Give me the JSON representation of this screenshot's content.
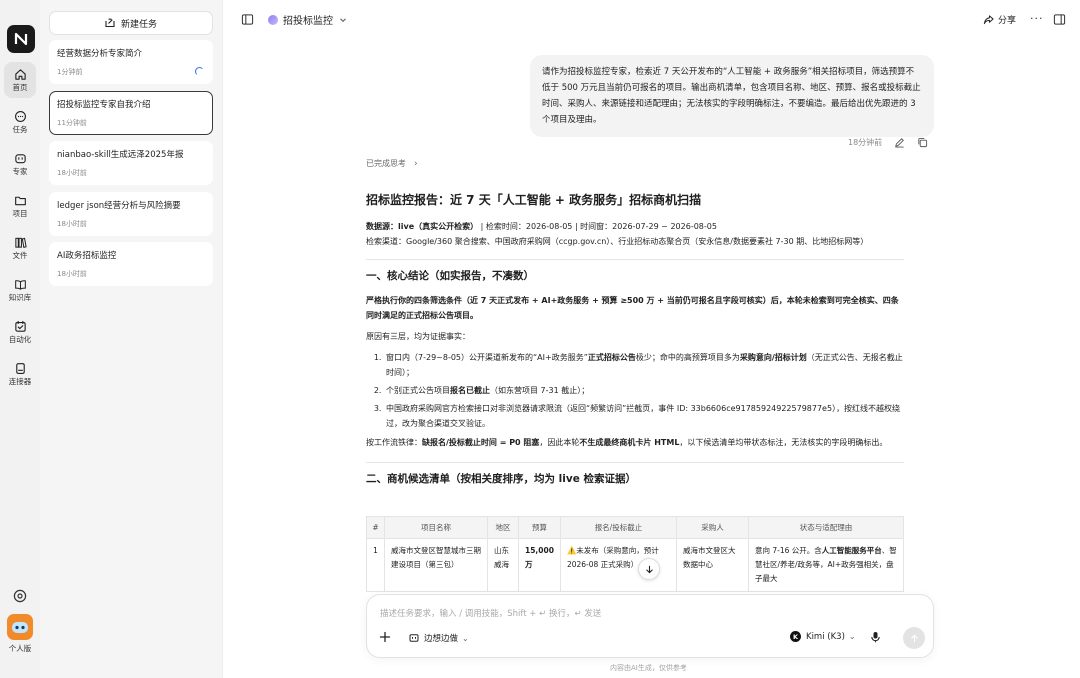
{
  "rail": {
    "items": [
      {
        "label": "首页",
        "icon": "home-icon"
      },
      {
        "label": "任务",
        "icon": "chat-icon"
      },
      {
        "label": "专家",
        "icon": "bot-icon"
      },
      {
        "label": "项目",
        "icon": "folder-icon"
      },
      {
        "label": "文件",
        "icon": "books-icon"
      },
      {
        "label": "知识库",
        "icon": "book-open-icon"
      },
      {
        "label": "自动化",
        "icon": "calendar-check-icon"
      },
      {
        "label": "连接器",
        "icon": "plug-icon"
      }
    ],
    "avatar_label": "个人版"
  },
  "tasks": {
    "new_task_label": "新建任务",
    "items": [
      {
        "title": "经营数据分析专家简介",
        "time": "1分钟前",
        "loading": true
      },
      {
        "title": "招投标监控专家自我介绍",
        "time": "11分钟前",
        "selected": true
      },
      {
        "title": "nianbao-skill生成远泽2025年报",
        "time": "18小时前"
      },
      {
        "title": "ledger json经营分析与风险摘要",
        "time": "18小时前"
      },
      {
        "title": "AI政务招标监控",
        "time": "18小时前"
      }
    ]
  },
  "header": {
    "title": "招投标监控",
    "share_label": "分享",
    "more": "···"
  },
  "conversation": {
    "user_message": "请作为招投标监控专家，检索近 7 天公开发布的“人工智能 + 政务服务”相关招标项目，筛选预算不低于 500 万元且当前仍可报名的项目。输出商机清单，包含项目名称、地区、预算、报名或投标截止时间、采购人、来源链接和适配理由；无法核实的字段明确标注，不要编造。最后给出优先跟进的 3 个项目及理由。",
    "user_message_time": "18分钟前",
    "thought_label": "已完成思考",
    "report": {
      "title": "招标监控报告：近 7 天「人工智能 + 政务服务」招标商机扫描",
      "source_label": "数据源：",
      "source_value": "live（真实公开检索）",
      "meta_rest": " | 检索时间：2026-08-05 | 时间窗：2026-07-29 ~ 2026-08-05",
      "channels": "检索渠道：Google/360 聚合搜索、中国政府采购网（ccgp.gov.cn）、行业招标动态聚合页（安永信息/数据要素社 7-30 期、比地招标网等）",
      "section1_title": "一、核心结论（如实报告，不凑数）",
      "section1_bold": "严格执行你的四条筛选条件（近 7 天正式发布 + AI+政务服务 + 预算 ≥500 万 + 当前仍可报名且字段可核实）后，本轮未检索到可完全核实、四条同时满足的正式招标公告项目。",
      "reason_intro": "原因有三层，均为证据事实：",
      "reasons": [
        {
          "a": "窗口内（7-29~8-05）公开渠道新发布的“AI+政务服务”",
          "b": "正式招标公告",
          "c": "极少；命中的高预算项目多为",
          "d": "采购意向/招标计划",
          "e": "（无正式公告、无报名截止时间）；"
        },
        {
          "a": "个别正式公告项目",
          "b": "报名已截止",
          "c": "（如东营项目 7-31 截止）；",
          "d": "",
          "e": ""
        },
        {
          "a": "中国政府采购网官方检索接口对非浏览器请求限流（返回“频繁访问”拦截页，事件 ID: 33b6606ce91785924922579877e5），按红线不越权绕过，改为聚合渠道交叉验证。",
          "b": "",
          "c": "",
          "d": "",
          "e": ""
        }
      ],
      "rule_a": "按工作流铁律：",
      "rule_b": "缺报名/投标截止时间 = P0 阻塞",
      "rule_c": "，因此本轮",
      "rule_d": "不生成最终商机卡片 HTML",
      "rule_e": "，以下候选清单均带状态标注，无法核实的字段明确标出。",
      "section2_title": "二、商机候选清单（按相关度排序，均为 live 检索证据）"
    },
    "table": {
      "headers": [
        "#",
        "项目名称",
        "地区",
        "预算",
        "报名/投标截止",
        "采购人",
        "状态与适配理由"
      ],
      "rows": [
        {
          "num": "1",
          "name": "威海市文登区智慧城市三期建设项目（第三包）",
          "region": "山东威海",
          "budget": "15,000 万",
          "deadline_icon": "⚠️",
          "deadline": "未发布（采购意向，预计 2026-08 正式采购）",
          "buyer": "威海市文登区大数据中心",
          "reason_a": "意向 7-16 公开。含",
          "reason_b": "人工智能服务平台",
          "reason_c": "、智慧社区/养老/政务等，AI+政务强相关，盘子最大"
        }
      ]
    }
  },
  "composer": {
    "placeholder": "描述任务要求，输入 / 调用技能，Shift + ↵ 换行，↵ 发送",
    "mode_label": "边想边做",
    "model_label": "Kimi (K3)"
  },
  "footer": {
    "disclaimer": "内容由AI生成，仅供参考"
  }
}
